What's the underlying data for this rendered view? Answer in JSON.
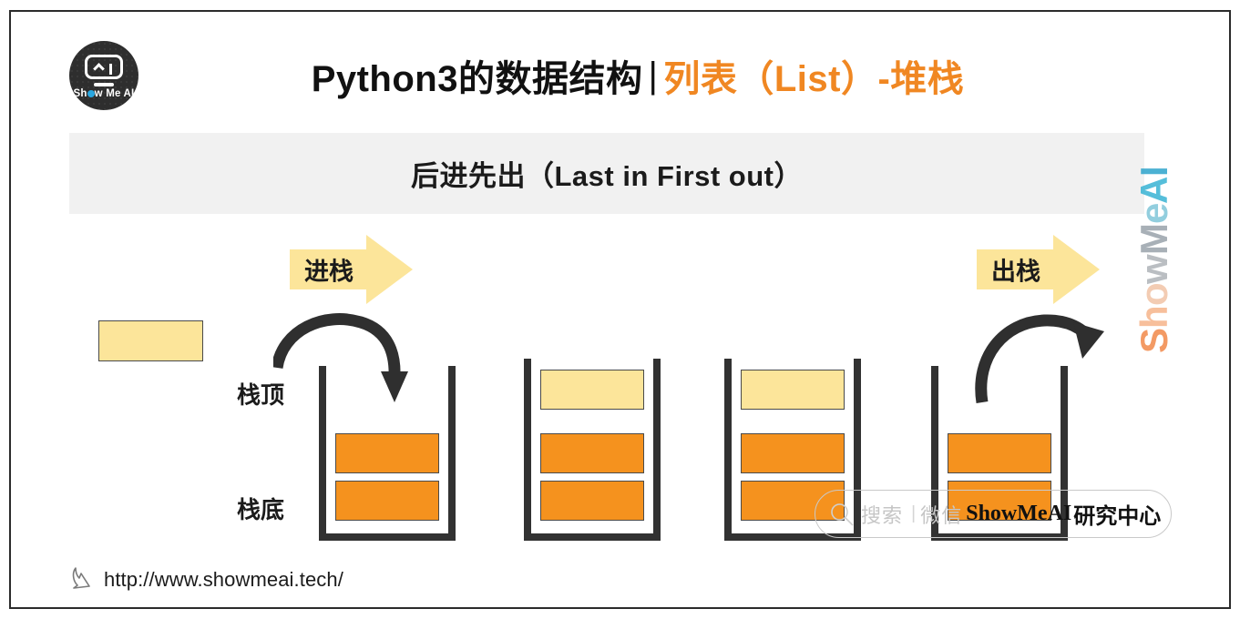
{
  "brand": {
    "logo_text": "Show Me AI",
    "logo_text_pre": "Sh",
    "logo_text_post": "w Me AI",
    "watermark_letters": [
      "S",
      "h",
      "o",
      "w",
      "M",
      "e",
      "A",
      "I"
    ],
    "watermark_text": "ShowMeAI"
  },
  "header": {
    "title_dark": "Python3的数据结构",
    "title_separator": "|",
    "title_accent": "列表（List）-堆栈",
    "title_full": "Python3的数据结构 | 列表（List）-堆栈"
  },
  "subtitle": {
    "text": "后进先出（Last in First out）"
  },
  "arrows": {
    "push_label": "进栈",
    "pop_label": "出栈"
  },
  "stack_labels": {
    "top": "栈顶",
    "bottom": "栈底"
  },
  "diagram": {
    "free_block_label": "",
    "stacks": [
      {
        "name": "stack-initial",
        "slots": [
          "orange",
          "orange"
        ]
      },
      {
        "name": "stack-after-push",
        "slots": [
          "orange",
          "orange",
          "cream"
        ]
      },
      {
        "name": "stack-full",
        "slots": [
          "orange",
          "orange",
          "cream"
        ]
      },
      {
        "name": "stack-after-pop",
        "slots": [
          "orange",
          "orange"
        ]
      }
    ]
  },
  "search_overlay": {
    "placeholder": "搜索",
    "divider": "|",
    "channel": "微信",
    "account_latin": "ShowMeAI",
    "account_cn": "研究中心"
  },
  "footer": {
    "url": "http://www.showmeai.tech/"
  },
  "colors": {
    "accent_orange": "#f08722",
    "block_orange": "#f5921e",
    "block_cream": "#fce59a",
    "band_gray": "#f1f1f1",
    "ink": "#2b2b2b"
  }
}
